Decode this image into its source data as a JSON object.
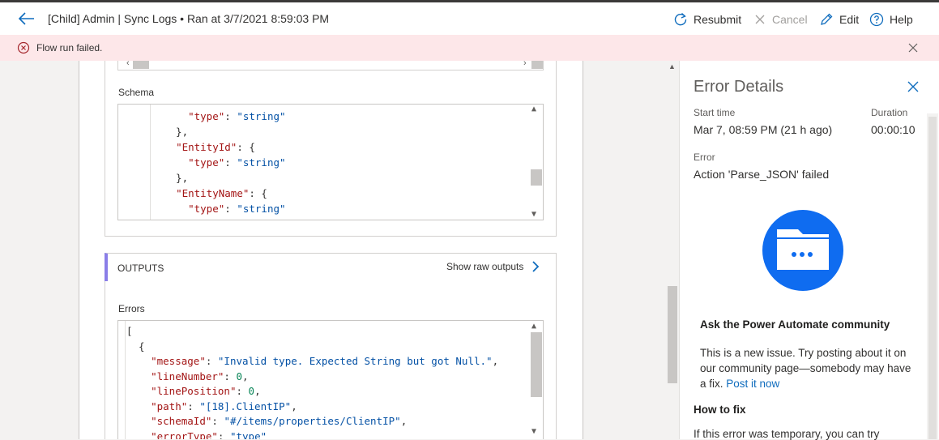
{
  "header": {
    "title": "[Child] Admin | Sync Logs • Ran at 3/7/2021 8:59:03 PM",
    "resubmit_label": "Resubmit",
    "cancel_label": "Cancel",
    "edit_label": "Edit",
    "help_label": "Help"
  },
  "banner": {
    "message": "Flow run failed."
  },
  "inputs": {
    "schema_label": "Schema",
    "schema_lines": [
      "    \"type\": \"string\"",
      "  },",
      "  \"EntityId\": {",
      "    \"type\": \"string\"",
      "  },",
      "  \"EntityName\": {",
      "    \"type\": \"string\""
    ]
  },
  "outputs": {
    "section_label": "OUTPUTS",
    "show_raw_label": "Show raw outputs",
    "errors_label": "Errors",
    "errors_lines": {
      "l0": "[",
      "l1": "  {",
      "l2_key": "\"message\"",
      "l2_val": "\"Invalid type. Expected String but got Null.\"",
      "l3_key": "\"lineNumber\"",
      "l3_val": "0",
      "l4_key": "\"linePosition\"",
      "l4_val": "0",
      "l5_key": "\"path\"",
      "l5_val": "\"[18].ClientIP\"",
      "l6_key": "\"schemaId\"",
      "l6_val": "\"#/items/properties/ClientIP\"",
      "l7_key": "\"errorType\"",
      "l7_val": "\"type\""
    }
  },
  "error_panel": {
    "title": "Error Details",
    "start_time_label": "Start time",
    "start_time_value": "Mar 7, 08:59 PM (21 h ago)",
    "duration_label": "Duration",
    "duration_value": "00:00:10",
    "error_label": "Error",
    "error_value": "Action 'Parse_JSON' failed",
    "community_heading": "Ask the Power Automate community",
    "community_text": "This is a new issue. Try posting about it on our community page—somebody may have a fix.",
    "community_link": "Post it now",
    "howto_heading": "How to fix",
    "howto_text": "If this error was temporary, you can try"
  },
  "colors": {
    "accent": "#0f6cbd",
    "error_banner": "#fde7e9",
    "outputs_bar": "#8a7ee8",
    "illustration": "#0f6cf0"
  }
}
